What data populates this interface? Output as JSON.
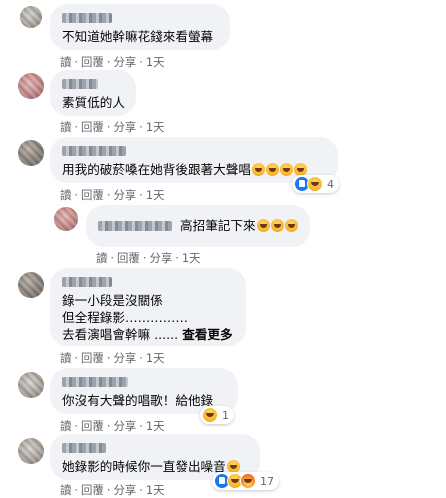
{
  "actions": {
    "read": "讀",
    "reply": "回覆",
    "share": "分享",
    "sep": "·"
  },
  "comments": [
    {
      "lines": [
        "不知道她幹嘛花錢來看螢幕"
      ],
      "time": "1天"
    },
    {
      "lines": [
        "素質低的人"
      ],
      "time": "1天"
    },
    {
      "lines": [
        "用我的破菸嗓在她背後跟著大聲唱"
      ],
      "time": "1天",
      "reaction_count": "4"
    },
    {
      "lines": [
        "高招筆記下來"
      ],
      "time": "1天"
    },
    {
      "lines": [
        "錄一小段是沒關係",
        "但全程錄影……………",
        "去看演唱會幹嘛 ......"
      ],
      "more": "查看更多",
      "time": "1天"
    },
    {
      "lines": [
        "你沒有大聲的唱歌！給他錄"
      ],
      "time": "1天",
      "reaction_count": "1"
    },
    {
      "lines": [
        "她錄影的時候你一直發出噪音"
      ],
      "time": "1天",
      "reaction_count": "17"
    }
  ],
  "colors": {
    "bubble": "#f0f2f5",
    "text": "#050505",
    "meta": "#65676b",
    "like": "#1877f2",
    "emoji": "#f7b125"
  }
}
